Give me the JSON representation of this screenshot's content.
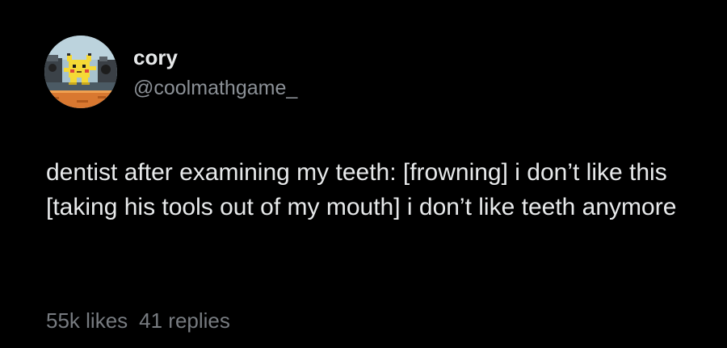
{
  "author": {
    "display_name": "cory",
    "handle": "@coolmathgame_"
  },
  "post": {
    "text": "dentist after examining my teeth: [frowning] i don’t like this [taking his tools out of my mouth] i don’t like teeth anymore"
  },
  "stats": {
    "likes": "55k likes",
    "replies": "41 replies"
  },
  "colors": {
    "background": "#000000",
    "primary_text": "#e7e9ea",
    "secondary_text": "#8b9096"
  },
  "icons": {
    "avatar": "avatar-pixel-art-icon"
  }
}
